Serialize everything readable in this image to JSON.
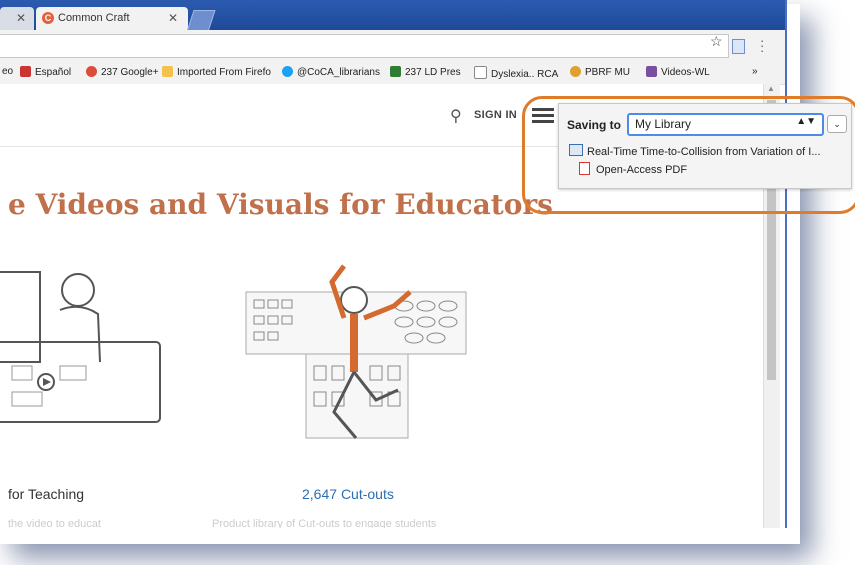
{
  "browser": {
    "tab_title": "Common Craft",
    "close_glyph": "✕",
    "bookmarks": [
      {
        "label": "eo",
        "color": ""
      },
      {
        "label": "Español",
        "color": "#cc3333"
      },
      {
        "label": "237 Google+",
        "color": "#dd4b39"
      },
      {
        "label": "Imported From Firefo",
        "color": "#f2c14e"
      },
      {
        "label": "@CoCA_librarians",
        "color": "#1da1f2"
      },
      {
        "label": "237 LD Pres",
        "color": "#2e7d32"
      },
      {
        "label": "Dyslexia.. RCA",
        "color": "#888888"
      },
      {
        "label": "PBRF MU",
        "color": "#e0a030"
      },
      {
        "label": "Videos-WL",
        "color": "#7a4fa0"
      }
    ],
    "overflow": "»"
  },
  "site": {
    "sign_in": "SIGN IN",
    "headline": "e Videos and Visuals for Educators",
    "caption_left": "for Teaching",
    "caption_right_number": "2,647",
    "caption_right_label": "Cut-outs",
    "faint_left": "the video to educat",
    "faint_right": "Product library of Cut-outs to engage students"
  },
  "zotero": {
    "saving_to_label": "Saving to",
    "library": "My Library",
    "item_title": "Real-Time Time-to-Collision from Variation of I...",
    "attachment": "Open-Access PDF"
  },
  "colors": {
    "accent_orange": "#e07b2a",
    "headline": "#c0704a",
    "link_blue": "#2a6fb3"
  }
}
